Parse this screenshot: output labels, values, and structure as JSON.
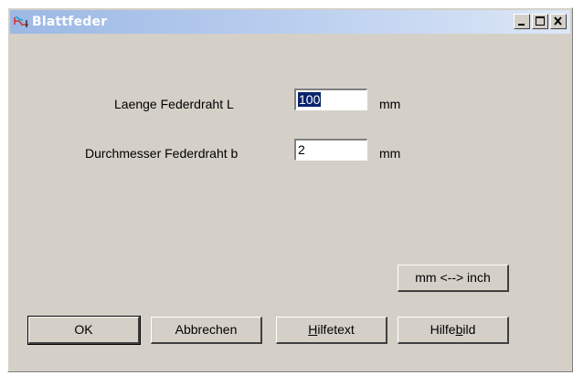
{
  "window": {
    "title": "Blattfeder",
    "controls": {
      "minimize_icon": "minimize-icon",
      "maximize_icon": "maximize-icon",
      "close_icon": "close-icon"
    }
  },
  "form": {
    "length": {
      "label": "Laenge Federdraht L",
      "value": "100",
      "unit": "mm"
    },
    "diameter": {
      "label": "Durchmesser Federdraht b",
      "value": "2",
      "unit": "mm"
    }
  },
  "buttons": {
    "convert": "mm <--> inch",
    "ok": "OK",
    "cancel": "Abbrechen",
    "help_text": {
      "pre": "",
      "accel": "H",
      "post": "ilfetext"
    },
    "help_image": {
      "pre": "Hilfe",
      "accel": "b",
      "post": "ild"
    }
  },
  "colors": {
    "selection": "#0a246a",
    "face": "#d4d0c8",
    "title_gradient_start": "#9cb8e4"
  }
}
